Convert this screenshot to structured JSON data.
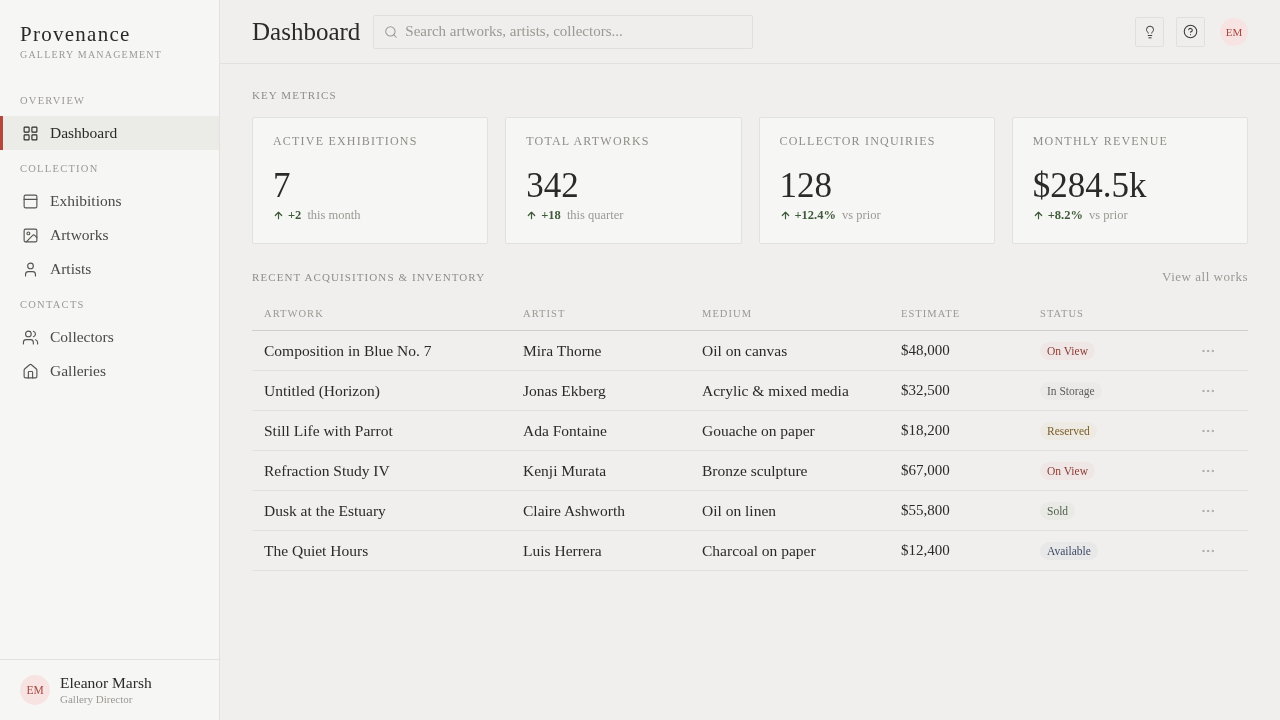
{
  "brand": {
    "name": "Provenance",
    "tagline": "GALLERY MANAGEMENT"
  },
  "sidebar": {
    "sections": [
      {
        "label": "OVERVIEW",
        "items": [
          {
            "label": "Dashboard",
            "selected": true
          }
        ]
      },
      {
        "label": "COLLECTION",
        "items": [
          {
            "label": "Exhibitions",
            "selected": false
          },
          {
            "label": "Artworks",
            "selected": false
          },
          {
            "label": "Artists",
            "selected": false
          }
        ]
      },
      {
        "label": "CONTACTS",
        "items": [
          {
            "label": "Collectors",
            "selected": false
          },
          {
            "label": "Galleries",
            "selected": false
          }
        ]
      }
    ],
    "user": {
      "initials": "EM",
      "name": "Eleanor Marsh",
      "role": "Gallery Director"
    }
  },
  "header": {
    "title": "Dashboard",
    "search": {
      "placeholder": "Search artworks, artists, collectors..."
    },
    "avatar": "EM"
  },
  "metrics": {
    "title": "KEY METRICS",
    "cards": [
      {
        "label": "ACTIVE EXHIBITIONS",
        "value": "7",
        "change": "+2",
        "period": "this month"
      },
      {
        "label": "TOTAL ARTWORKS",
        "value": "342",
        "change": "+18",
        "period": "this quarter"
      },
      {
        "label": "COLLECTOR INQUIRIES",
        "value": "128",
        "change": "+12.4%",
        "period": "vs prior"
      },
      {
        "label": "MONTHLY REVENUE",
        "value": "$284.5k",
        "change": "+8.2%",
        "period": "vs prior"
      }
    ]
  },
  "inventory": {
    "title": "RECENT ACQUISITIONS & INVENTORY",
    "link": "View all works",
    "columns": [
      "ARTWORK",
      "ARTIST",
      "MEDIUM",
      "ESTIMATE",
      "STATUS"
    ],
    "rows": [
      {
        "artwork": "Composition in Blue No. 7",
        "artist": "Mira Thorne",
        "medium": "Oil on canvas",
        "estimate": "$48,000",
        "status": "On View",
        "color": "#8e3a34"
      },
      {
        "artwork": "Untitled (Horizon)",
        "artist": "Jonas Ekberg",
        "medium": "Acrylic & mixed media",
        "estimate": "$32,500",
        "status": "In Storage",
        "color": "#5e5d59"
      },
      {
        "artwork": "Still Life with Parrot",
        "artist": "Ada Fontaine",
        "medium": "Gouache on paper",
        "estimate": "$18,200",
        "status": "Reserved",
        "color": "#7a5c26"
      },
      {
        "artwork": "Refraction Study IV",
        "artist": "Kenji Murata",
        "medium": "Bronze sculpture",
        "estimate": "$67,000",
        "status": "On View",
        "color": "#8e3a34"
      },
      {
        "artwork": "Dusk at the Estuary",
        "artist": "Claire Ashworth",
        "medium": "Oil on linen",
        "estimate": "$55,800",
        "status": "Sold",
        "color": "#4e5f48"
      },
      {
        "artwork": "The Quiet Hours",
        "artist": "Luis Herrera",
        "medium": "Charcoal on paper",
        "estimate": "$12,400",
        "status": "Available",
        "color": "#3e4a66"
      }
    ]
  }
}
